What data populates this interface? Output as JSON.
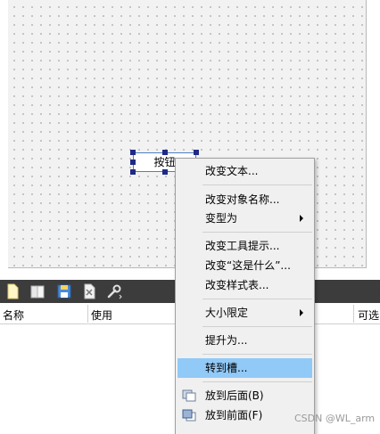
{
  "widget": {
    "label": "按钮"
  },
  "property_header": {
    "columns": [
      "名称",
      "使用",
      "可选"
    ]
  },
  "toolbar": {
    "icons": [
      "new-file-icon",
      "open-file-icon",
      "save-file-icon",
      "delete-icon",
      "wrench-icon"
    ]
  },
  "context_menu": {
    "items": [
      {
        "label": "改变文本...",
        "submenu": false,
        "highlighted": false
      },
      {
        "label": "改变对象名称...",
        "submenu": false,
        "highlighted": false
      },
      {
        "label": "变型为",
        "submenu": true,
        "highlighted": false
      },
      {
        "label": "改变工具提示...",
        "submenu": false,
        "highlighted": false
      },
      {
        "label": "改变“这是什么”...",
        "submenu": false,
        "highlighted": false
      },
      {
        "label": "改变样式表...",
        "submenu": false,
        "highlighted": false
      },
      {
        "label": "大小限定",
        "submenu": true,
        "highlighted": false
      },
      {
        "label": "提升为...",
        "submenu": false,
        "highlighted": false
      },
      {
        "label": "转到槽...",
        "submenu": false,
        "highlighted": true
      },
      {
        "label": "放到后面(B)",
        "submenu": false,
        "highlighted": false,
        "icon": "send-to-back-icon"
      },
      {
        "label": "放到前面(F)",
        "submenu": false,
        "highlighted": false,
        "icon": "bring-to-front-icon"
      }
    ]
  },
  "watermark": "CSDN @WL_arm",
  "colors": {
    "highlight": "#91c9f7",
    "toolbar_bg": "#3c3c3c",
    "handle": "#1f2a86",
    "selection_border": "#4c7fc2"
  }
}
